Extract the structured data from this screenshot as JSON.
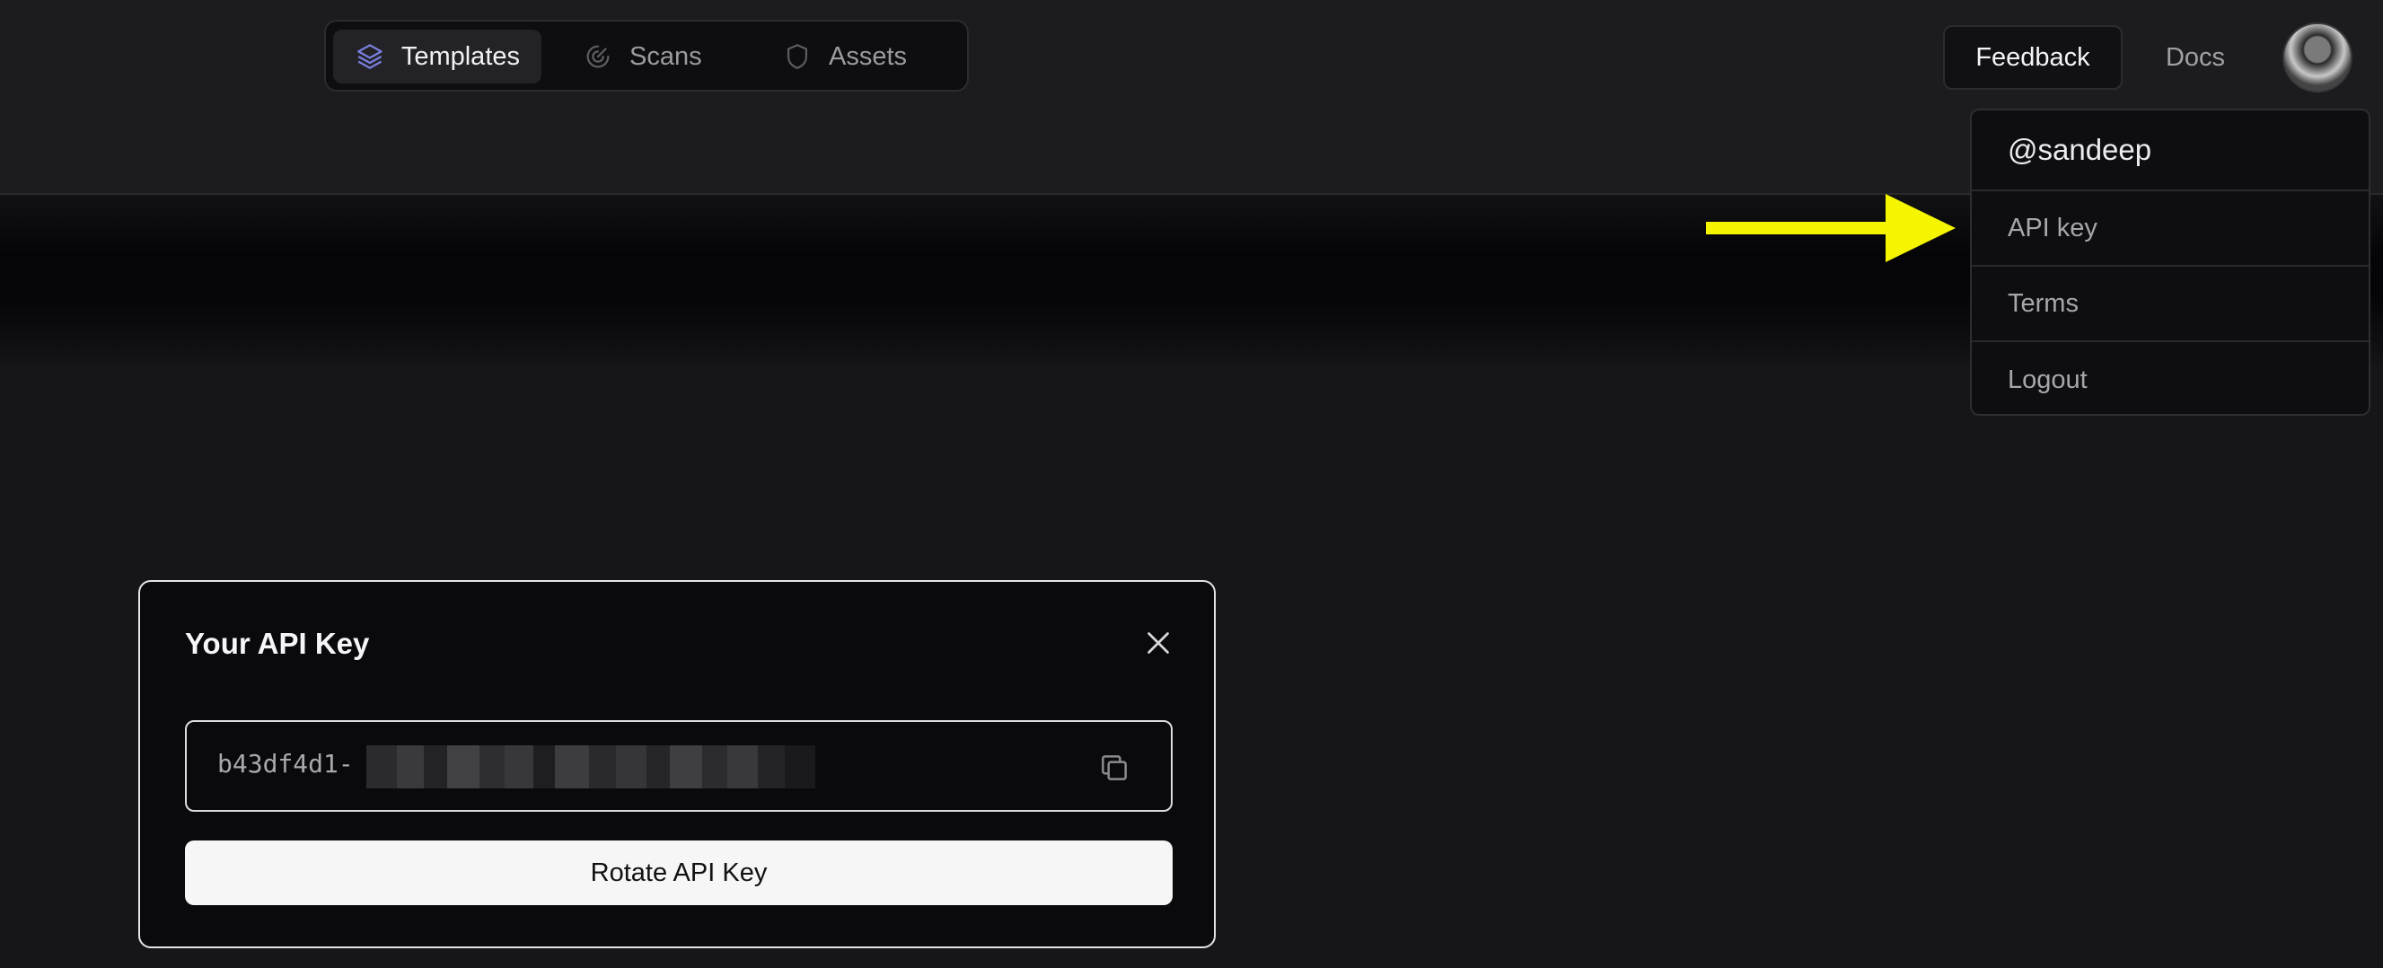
{
  "nav": {
    "tabs": [
      {
        "label": "Templates",
        "icon": "layers-icon",
        "active": true
      },
      {
        "label": "Scans",
        "icon": "radar-icon",
        "active": false
      },
      {
        "label": "Assets",
        "icon": "shield-icon",
        "active": false
      }
    ]
  },
  "header": {
    "feedback_label": "Feedback",
    "docs_label": "Docs",
    "avatar_icon": "user-avatar"
  },
  "user_menu": {
    "username": "@sandeep",
    "items": [
      {
        "label": "API key"
      },
      {
        "label": "Terms"
      },
      {
        "label": "Logout"
      }
    ]
  },
  "annotation": {
    "arrow_color": "#f5f500",
    "arrow_icon": "arrow-right-icon"
  },
  "api_key_modal": {
    "title": "Your API Key",
    "key_visible_prefix": "b43df4d1-",
    "key_redacted": true,
    "rotate_label": "Rotate API Key",
    "close_icon": "close-icon",
    "copy_icon": "copy-icon"
  },
  "colors": {
    "background": "#18181a",
    "accent_icon": "#7a7fe0",
    "modal_border": "#e4e4e8"
  }
}
